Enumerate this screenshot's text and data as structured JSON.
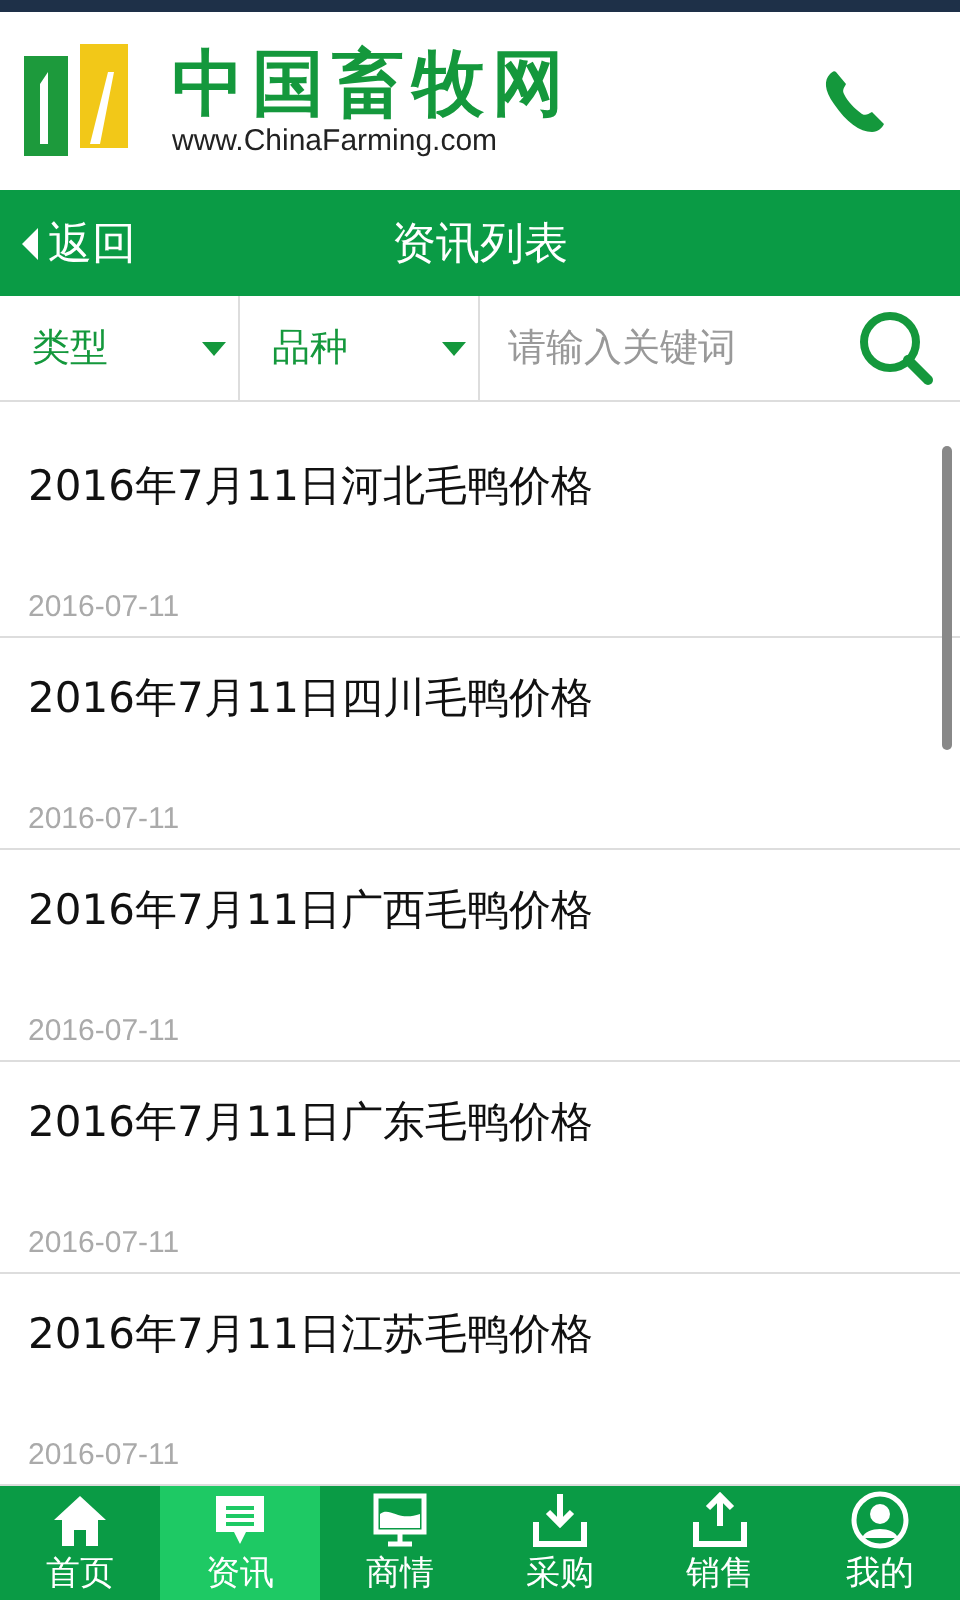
{
  "header": {
    "logo_title": "中国畜牧网",
    "logo_url": "www.ChinaFarming.com"
  },
  "nav": {
    "back": "返回",
    "title": "资讯列表"
  },
  "filters": [
    {
      "label": "类型"
    },
    {
      "label": "品种"
    }
  ],
  "search": {
    "placeholder": "请输入关键词"
  },
  "articles": [
    {
      "title": "2016年7月11日河北毛鸭价格",
      "date": "2016-07-11"
    },
    {
      "title": "2016年7月11日四川毛鸭价格",
      "date": "2016-07-11"
    },
    {
      "title": "2016年7月11日广西毛鸭价格",
      "date": "2016-07-11"
    },
    {
      "title": "2016年7月11日广东毛鸭价格",
      "date": "2016-07-11"
    },
    {
      "title": "2016年7月11日江苏毛鸭价格",
      "date": "2016-07-11"
    }
  ],
  "tabs": [
    {
      "label": "首页",
      "selected": false
    },
    {
      "label": "资讯",
      "selected": true
    },
    {
      "label": "商情",
      "selected": false
    },
    {
      "label": "采购",
      "selected": false
    },
    {
      "label": "销售",
      "selected": false
    },
    {
      "label": "我的",
      "selected": false
    }
  ]
}
